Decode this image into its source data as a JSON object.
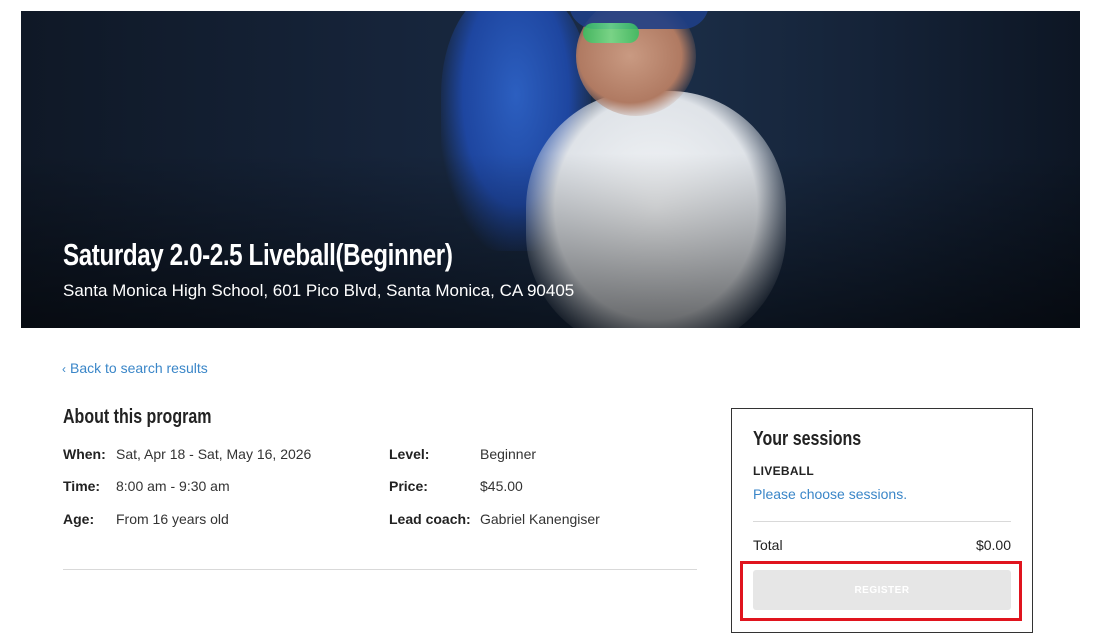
{
  "hero": {
    "title": "Saturday 2.0-2.5 Liveball(Beginner)",
    "address": "Santa Monica High School, 601 Pico Blvd, Santa Monica, CA 90405"
  },
  "nav": {
    "back_chevron": "‹",
    "back_label": "Back to search results"
  },
  "about": {
    "title": "About this program",
    "when_label": "When:",
    "when_value": "Sat, Apr 18 - Sat, May 16, 2026",
    "time_label": "Time:",
    "time_value": "8:00 am - 9:30 am",
    "age_label": "Age:",
    "age_value": "From 16 years old",
    "level_label": "Level:",
    "level_value": "Beginner",
    "price_label": "Price:",
    "price_value": "$45.00",
    "coach_label": "Lead coach:",
    "coach_value": "Gabriel Kanengiser"
  },
  "sessions": {
    "title": "Your sessions",
    "category": "LIVEBALL",
    "choose_prompt": "Please choose sessions.",
    "total_label": "Total",
    "total_value": "$0.00",
    "register_label": "REGISTER"
  },
  "colors": {
    "link": "#3a86c8",
    "highlight": "#e0141e",
    "button_disabled": "#e6e6e6"
  }
}
